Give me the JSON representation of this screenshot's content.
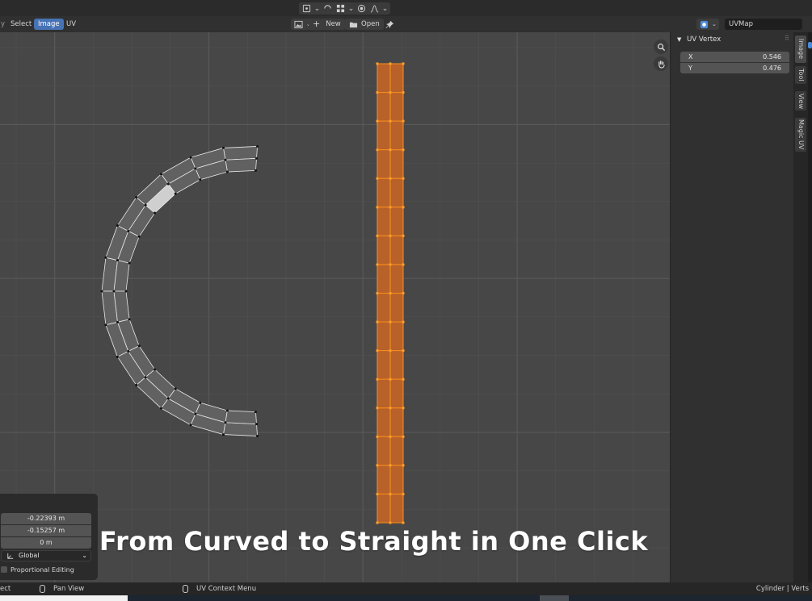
{
  "header": {
    "menus": [
      {
        "label": "Select",
        "active": false
      },
      {
        "label": "Image",
        "active": true
      },
      {
        "label": "UV",
        "active": false
      }
    ],
    "new_label": "New",
    "open_label": "Open",
    "uvmap_name": "UVMap"
  },
  "sidebar": {
    "panel_title": "UV Vertex",
    "x_label": "X",
    "x_value": "0.546",
    "y_label": "Y",
    "y_value": "0.476",
    "tabs": [
      "Image",
      "Tool",
      "View",
      "Magic UV"
    ]
  },
  "redo_panel": {
    "offset_x": "-0.22393 m",
    "offset_y": "-0.15257 m",
    "offset_z": "0 m",
    "orientation": "Global",
    "proportional_editing": "Proportional Editing"
  },
  "caption": "From Curved to Straight in One Click",
  "statusbar": {
    "left_fragment": "ect",
    "pan_view": "Pan View",
    "context_menu": "UV Context Menu",
    "scene_info": "Cylinder | Verts"
  },
  "colors": {
    "viewport_bg": "#474747",
    "straight_strip_fill": "#b8622a",
    "straight_strip_edge": "#f28a1e",
    "curved_face_fill": "#616161",
    "selected_face_fill": "#cfcfcf",
    "active_menu": "#4772b3"
  }
}
